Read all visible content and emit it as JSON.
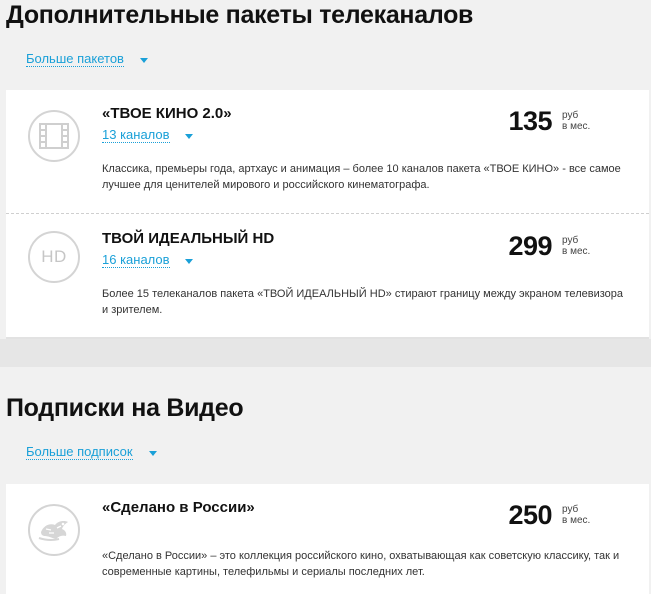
{
  "packages_section": {
    "title": "Дополнительные пакеты телеканалов",
    "more_link": "Больше пакетов",
    "items": [
      {
        "title": "«ТВОЕ КИНО 2.0»",
        "channels": "13 каналов",
        "price": "135",
        "unit_line1": "руб",
        "unit_line2": "в мес.",
        "description": "Классика, премьеры года, артхаус и анимация – более 10 каналов пакета «ТВОЕ КИНО» - все самое лучшее для ценителей мирового и российского кинематографа.",
        "icon": "film-icon"
      },
      {
        "title": "ТВОЙ ИДЕАЛЬНЫЙ HD",
        "channels": "16 каналов",
        "price": "299",
        "unit_line1": "руб",
        "unit_line2": "в мес.",
        "description": "Более 15 телеканалов пакета «ТВОЙ ИДЕАЛЬНЫЙ HD» стирают границу между экраном телевизора и зрителем.",
        "icon": "hd-icon",
        "icon_text": "HD"
      }
    ]
  },
  "video_section": {
    "title": "Подписки на Видео",
    "more_link": "Больше подписок",
    "items": [
      {
        "title": "«Сделано в России»",
        "price": "250",
        "unit_line1": "руб",
        "unit_line2": "в мес.",
        "description": "«Сделано в России» – это коллекция российского кино, охватывающая как советскую классику, так и современные картины, телефильмы и сериалы последних лет.",
        "icon": "bird-emblem-icon"
      }
    ]
  },
  "colors": {
    "accent": "#1aa0d8",
    "background": "#f1f1f1",
    "card": "#ffffff"
  }
}
